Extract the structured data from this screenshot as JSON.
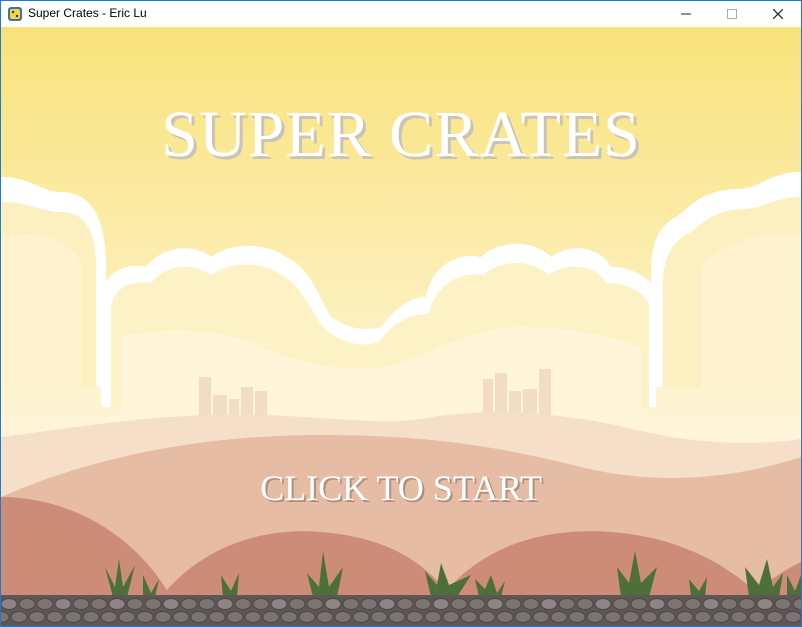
{
  "window": {
    "title": "Super Crates - Eric Lu",
    "app_icon": "python-icon",
    "controls": {
      "minimize": "minimize-icon",
      "maximize": "maximize-icon",
      "close": "close-icon"
    }
  },
  "game": {
    "title": "SUPER CRATES",
    "start_prompt": "CLICK TO START",
    "colors": {
      "sky": "#f9e27a",
      "cloud": "#ffffff",
      "hill_back": "#f5dcc8",
      "hill_mid": "#e4b7a0",
      "hill_front": "#cc8c78",
      "plant": "#4a6f3a",
      "stone": "#7f7676"
    }
  }
}
